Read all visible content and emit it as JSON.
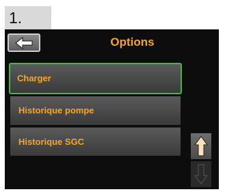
{
  "step": "1.",
  "header": {
    "title": "Options",
    "back_icon": "back-arrow-icon"
  },
  "menu": {
    "items": [
      {
        "label": "Charger",
        "selected": true
      },
      {
        "label": "Historique pompe",
        "selected": false
      },
      {
        "label": "Historique SGC",
        "selected": false
      }
    ]
  },
  "scroll": {
    "up_icon": "arrow-up-icon",
    "down_icon": "arrow-down-icon",
    "up_enabled": true,
    "down_enabled": false
  },
  "colors": {
    "accent": "#f5a623",
    "selection_border": "#46b84a",
    "background": "#0d0d0d"
  }
}
